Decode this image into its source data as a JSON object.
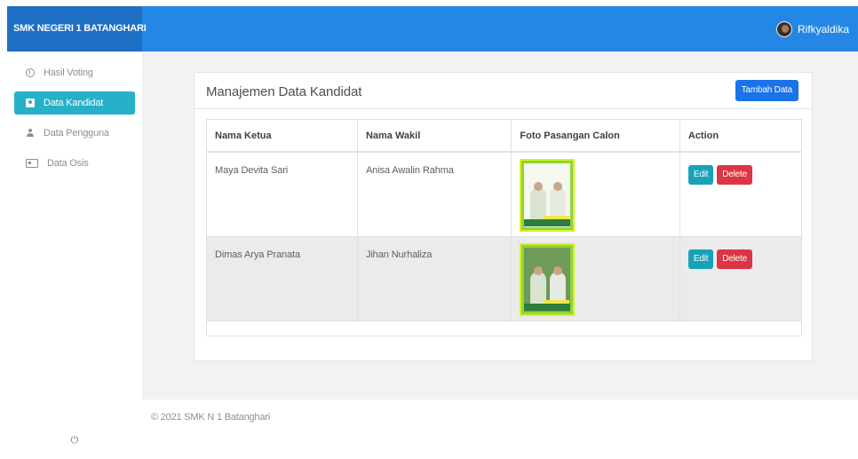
{
  "header": {
    "brand": "SMK NEGERI 1 BATANGHARI",
    "username": "Rifkyaldika"
  },
  "sidebar": {
    "items": [
      {
        "label": "Hasil Voting",
        "icon": "clock-icon",
        "active": false
      },
      {
        "label": "Data Kandidat",
        "icon": "id-card-icon",
        "active": true
      },
      {
        "label": "Data Pengguna",
        "icon": "user-icon",
        "active": false
      },
      {
        "label": "Data Osis",
        "icon": "address-card-icon",
        "active": false
      }
    ],
    "power_icon": "⏻"
  },
  "main": {
    "title": "Manajemen Data Kandidat",
    "add_button": "Tambah Data",
    "table": {
      "headers": [
        "Nama Ketua",
        "Nama Wakil",
        "Foto Pasangan Calon",
        "Action"
      ],
      "rows": [
        {
          "ketua": "Maya Devita Sari",
          "wakil": "Anisa Awalin Rahma",
          "photo": "candidate-photo-1"
        },
        {
          "ketua": "Dimas Arya Pranata",
          "wakil": "Jihan Nurhaliza",
          "photo": "candidate-photo-2"
        }
      ],
      "edit_label": "Edit",
      "delete_label": "Delete"
    }
  },
  "footer": {
    "text": "© 2021 SMK N 1 Batanghari"
  },
  "colors": {
    "topbar": "#2487e6",
    "active_nav": "#25b1c8",
    "add_button": "#1a73e8",
    "edit": "#17a2b8",
    "delete": "#dc3545"
  }
}
